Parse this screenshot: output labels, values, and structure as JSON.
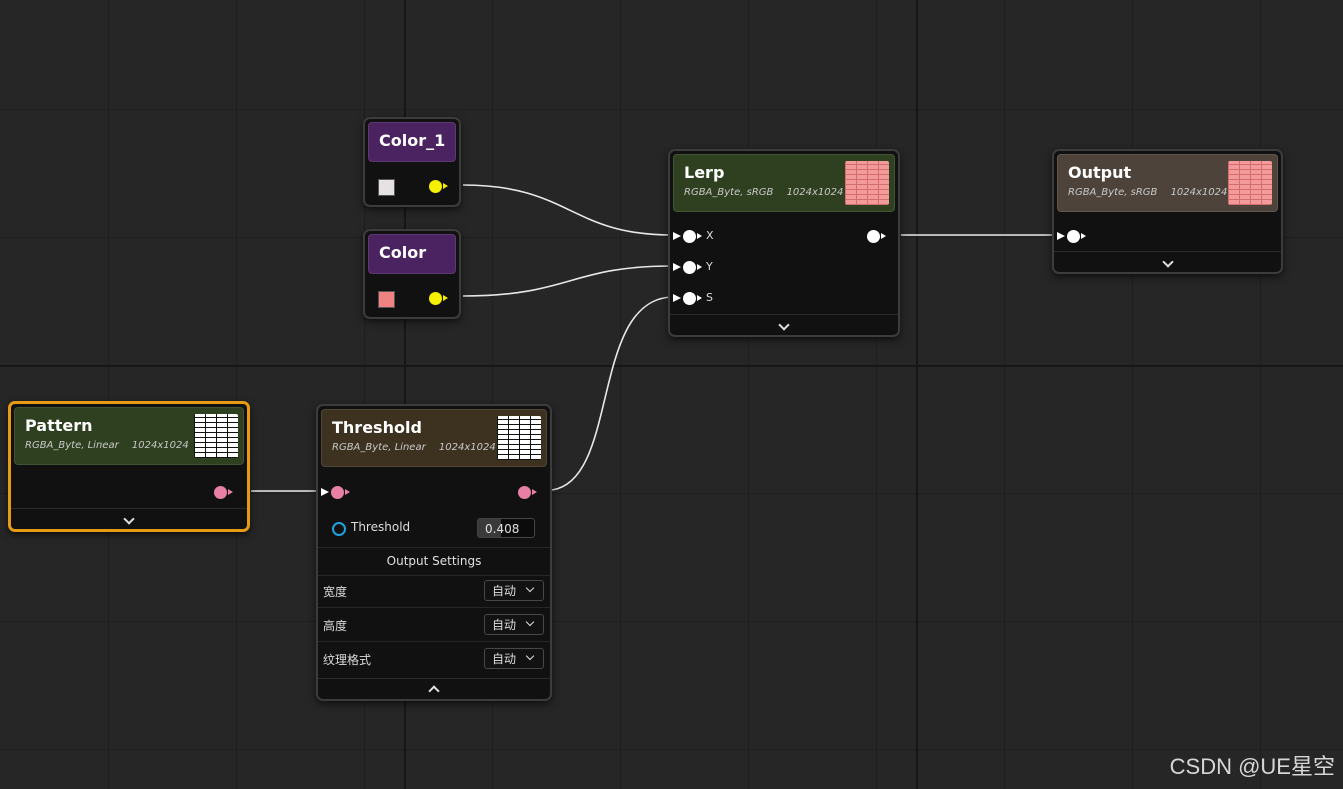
{
  "nodes": {
    "color1": {
      "title": "Color_1",
      "swatch_color": "#e6e2e4"
    },
    "color": {
      "title": "Color",
      "swatch_color": "#f08282"
    },
    "lerp": {
      "title": "Lerp",
      "format": "RGBA_Byte, sRGB",
      "size": "1024x1024",
      "inputs": [
        "X",
        "Y",
        "S"
      ]
    },
    "output": {
      "title": "Output",
      "format": "RGBA_Byte, sRGB",
      "size": "1024x1024"
    },
    "pattern": {
      "title": "Pattern",
      "format": "RGBA_Byte, Linear",
      "size": "1024x1024"
    },
    "threshold": {
      "title": "Threshold",
      "format": "RGBA_Byte, Linear",
      "size": "1024x1024",
      "param_label": "Threshold",
      "param_value": "0.408",
      "param_fraction": 0.408,
      "output_settings_title": "Output Settings",
      "settings": [
        {
          "label": "宽度",
          "value": "自动"
        },
        {
          "label": "高度",
          "value": "自动"
        },
        {
          "label": "纹理格式",
          "value": "自动"
        }
      ]
    }
  },
  "colors": {
    "selection": "#e79b14",
    "float_pin": "#f5f000",
    "texture_pin": "#e87fa5",
    "exec_pin": "#ffffff"
  },
  "watermark": "CSDN @UE星空"
}
